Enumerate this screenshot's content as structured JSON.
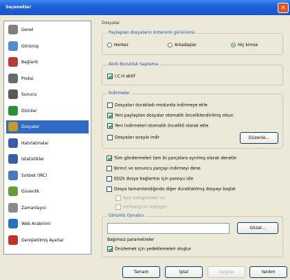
{
  "window": {
    "title": "Seçenekler"
  },
  "sidebar": {
    "items": [
      {
        "label": "Genel",
        "icon": "gear-icon",
        "color": "#7f7f7f"
      },
      {
        "label": "Görünüş",
        "icon": "appearance-icon",
        "color": "#5a8ac6"
      },
      {
        "label": "Bağlantı",
        "icon": "connection-icon",
        "color": "#b83b3b"
      },
      {
        "label": "Proksi",
        "icon": "proxy-icon",
        "color": "#6a6a6a"
      },
      {
        "label": "Sunucu",
        "icon": "server-icon",
        "color": "#5a5a5a"
      },
      {
        "label": "Dizinler",
        "icon": "folders-icon",
        "color": "#2d8f3c"
      },
      {
        "label": "Dosyalar",
        "icon": "files-icon",
        "color": "#c49a2c"
      },
      {
        "label": "Hatırlatmalar",
        "icon": "reminders-icon",
        "color": "#3b5ea8"
      },
      {
        "label": "İstatistikler",
        "icon": "statistics-icon",
        "color": "#3b5ea8"
      },
      {
        "label": "Sohbet (IRC)",
        "icon": "irc-chat-icon",
        "color": "#4a7ab8"
      },
      {
        "label": "Güvenlik",
        "icon": "security-icon",
        "color": "#6a9a3c"
      },
      {
        "label": "Zamanlayıcı",
        "icon": "scheduler-icon",
        "color": "#8a8a8a"
      },
      {
        "label": "Web Arabirimi",
        "icon": "web-interface-icon",
        "color": "#2d6fbf"
      },
      {
        "label": "Genişletilmiş Ayarlar",
        "icon": "extended-settings-icon",
        "color": "#c4302c"
      }
    ],
    "active_index": 6
  },
  "main": {
    "section_title": "Dosyalar",
    "sharing": {
      "title": "Paylaşılan dosyaların öntanımlı görünümü",
      "options": [
        "Herkes",
        "Arkadaşlar",
        "Hiç kimse"
      ],
      "selected": "Hiç kimse"
    },
    "ich": {
      "title": "Akıllı Bozukluk Saptama",
      "checkbox": "I.C.H aktif",
      "checked": true
    },
    "downloads": {
      "title": "İndirmeler",
      "items": [
        {
          "label": "Dosyaları durakladı modunda indirmeye ekle",
          "checked": false
        },
        {
          "label": "Yeni paylaşılan dosyalar otomatik önceliklendirilmiş olsun",
          "checked": true
        },
        {
          "label": "Yeni indirmeleri otomatik öncelikli olarak ekle",
          "checked": true
        },
        {
          "label": "Dosyaları sırayla indir",
          "checked": false
        }
      ],
      "browse_button": "Düzenle..."
    },
    "misc": {
      "items": [
        {
          "label": "Tüm göndermeleri tam iki parçalara ayrılmış olarak denetle",
          "checked": true,
          "disabled": false
        },
        {
          "label": "Birinci ve sonuncu parçayı indirmeyi dene",
          "checked": false,
          "disabled": false
        },
        {
          "label": "ED2k dosya bağlantısı için panoyu izle",
          "checked": false,
          "disabled": false
        },
        {
          "label": "Dosya tamamlandığında diğer duraklatılmış dosyayı başlat",
          "checked": false,
          "disabled": false
        },
        {
          "label": "Aynı kategorideki ve",
          "checked": false,
          "disabled": true
        },
        {
          "label": "Herhangi bir kategori",
          "checked": false,
          "disabled": true
        }
      ]
    },
    "viewer": {
      "title": "Görüntü Oynatıcı",
      "path_value": "",
      "browse_button": "Gözat...",
      "note": "Bağımsız parametreler",
      "checkbox": "Önizlemek için yedeklemeleri oluştur",
      "checked": true
    }
  },
  "footer": {
    "ok": "Tamam",
    "cancel": "İptal",
    "apply": "Uygula",
    "help": "Yardım"
  }
}
